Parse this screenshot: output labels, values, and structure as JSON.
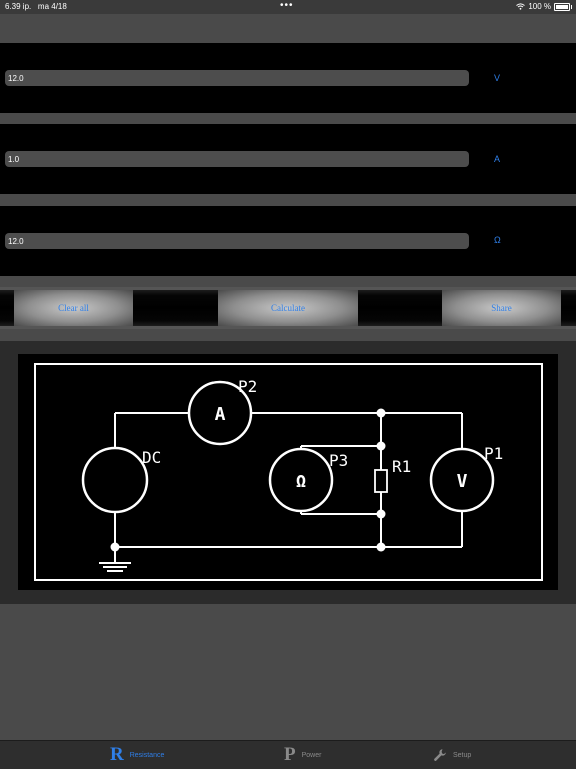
{
  "status": {
    "time": "6.39 ip.",
    "date": "ma 4/18",
    "more": "•••",
    "battery": "100 %"
  },
  "fields": [
    {
      "value": "12.0",
      "unit": "V"
    },
    {
      "value": "1.0",
      "unit": "A"
    },
    {
      "value": "12.0",
      "unit": "Ω"
    }
  ],
  "buttons": {
    "clear": "Clear all",
    "calculate": "Calculate",
    "share": "Share"
  },
  "diagram": {
    "p2": "P2",
    "dc": "DC",
    "p3": "P3",
    "r1": "R1",
    "p1": "P1",
    "ammeter": "A",
    "ohmmeter": "Ω",
    "voltmeter": "V"
  },
  "tabs": [
    {
      "glyph": "R",
      "label": "Resistance",
      "active": true
    },
    {
      "glyph": "P",
      "label": "Power",
      "active": false
    },
    {
      "glyph": "",
      "label": "Setup",
      "icon": "wrench-icon",
      "active": false
    }
  ],
  "colors": {
    "accent": "#2f7fe8",
    "tab_inactive": "#8a8a8a"
  }
}
